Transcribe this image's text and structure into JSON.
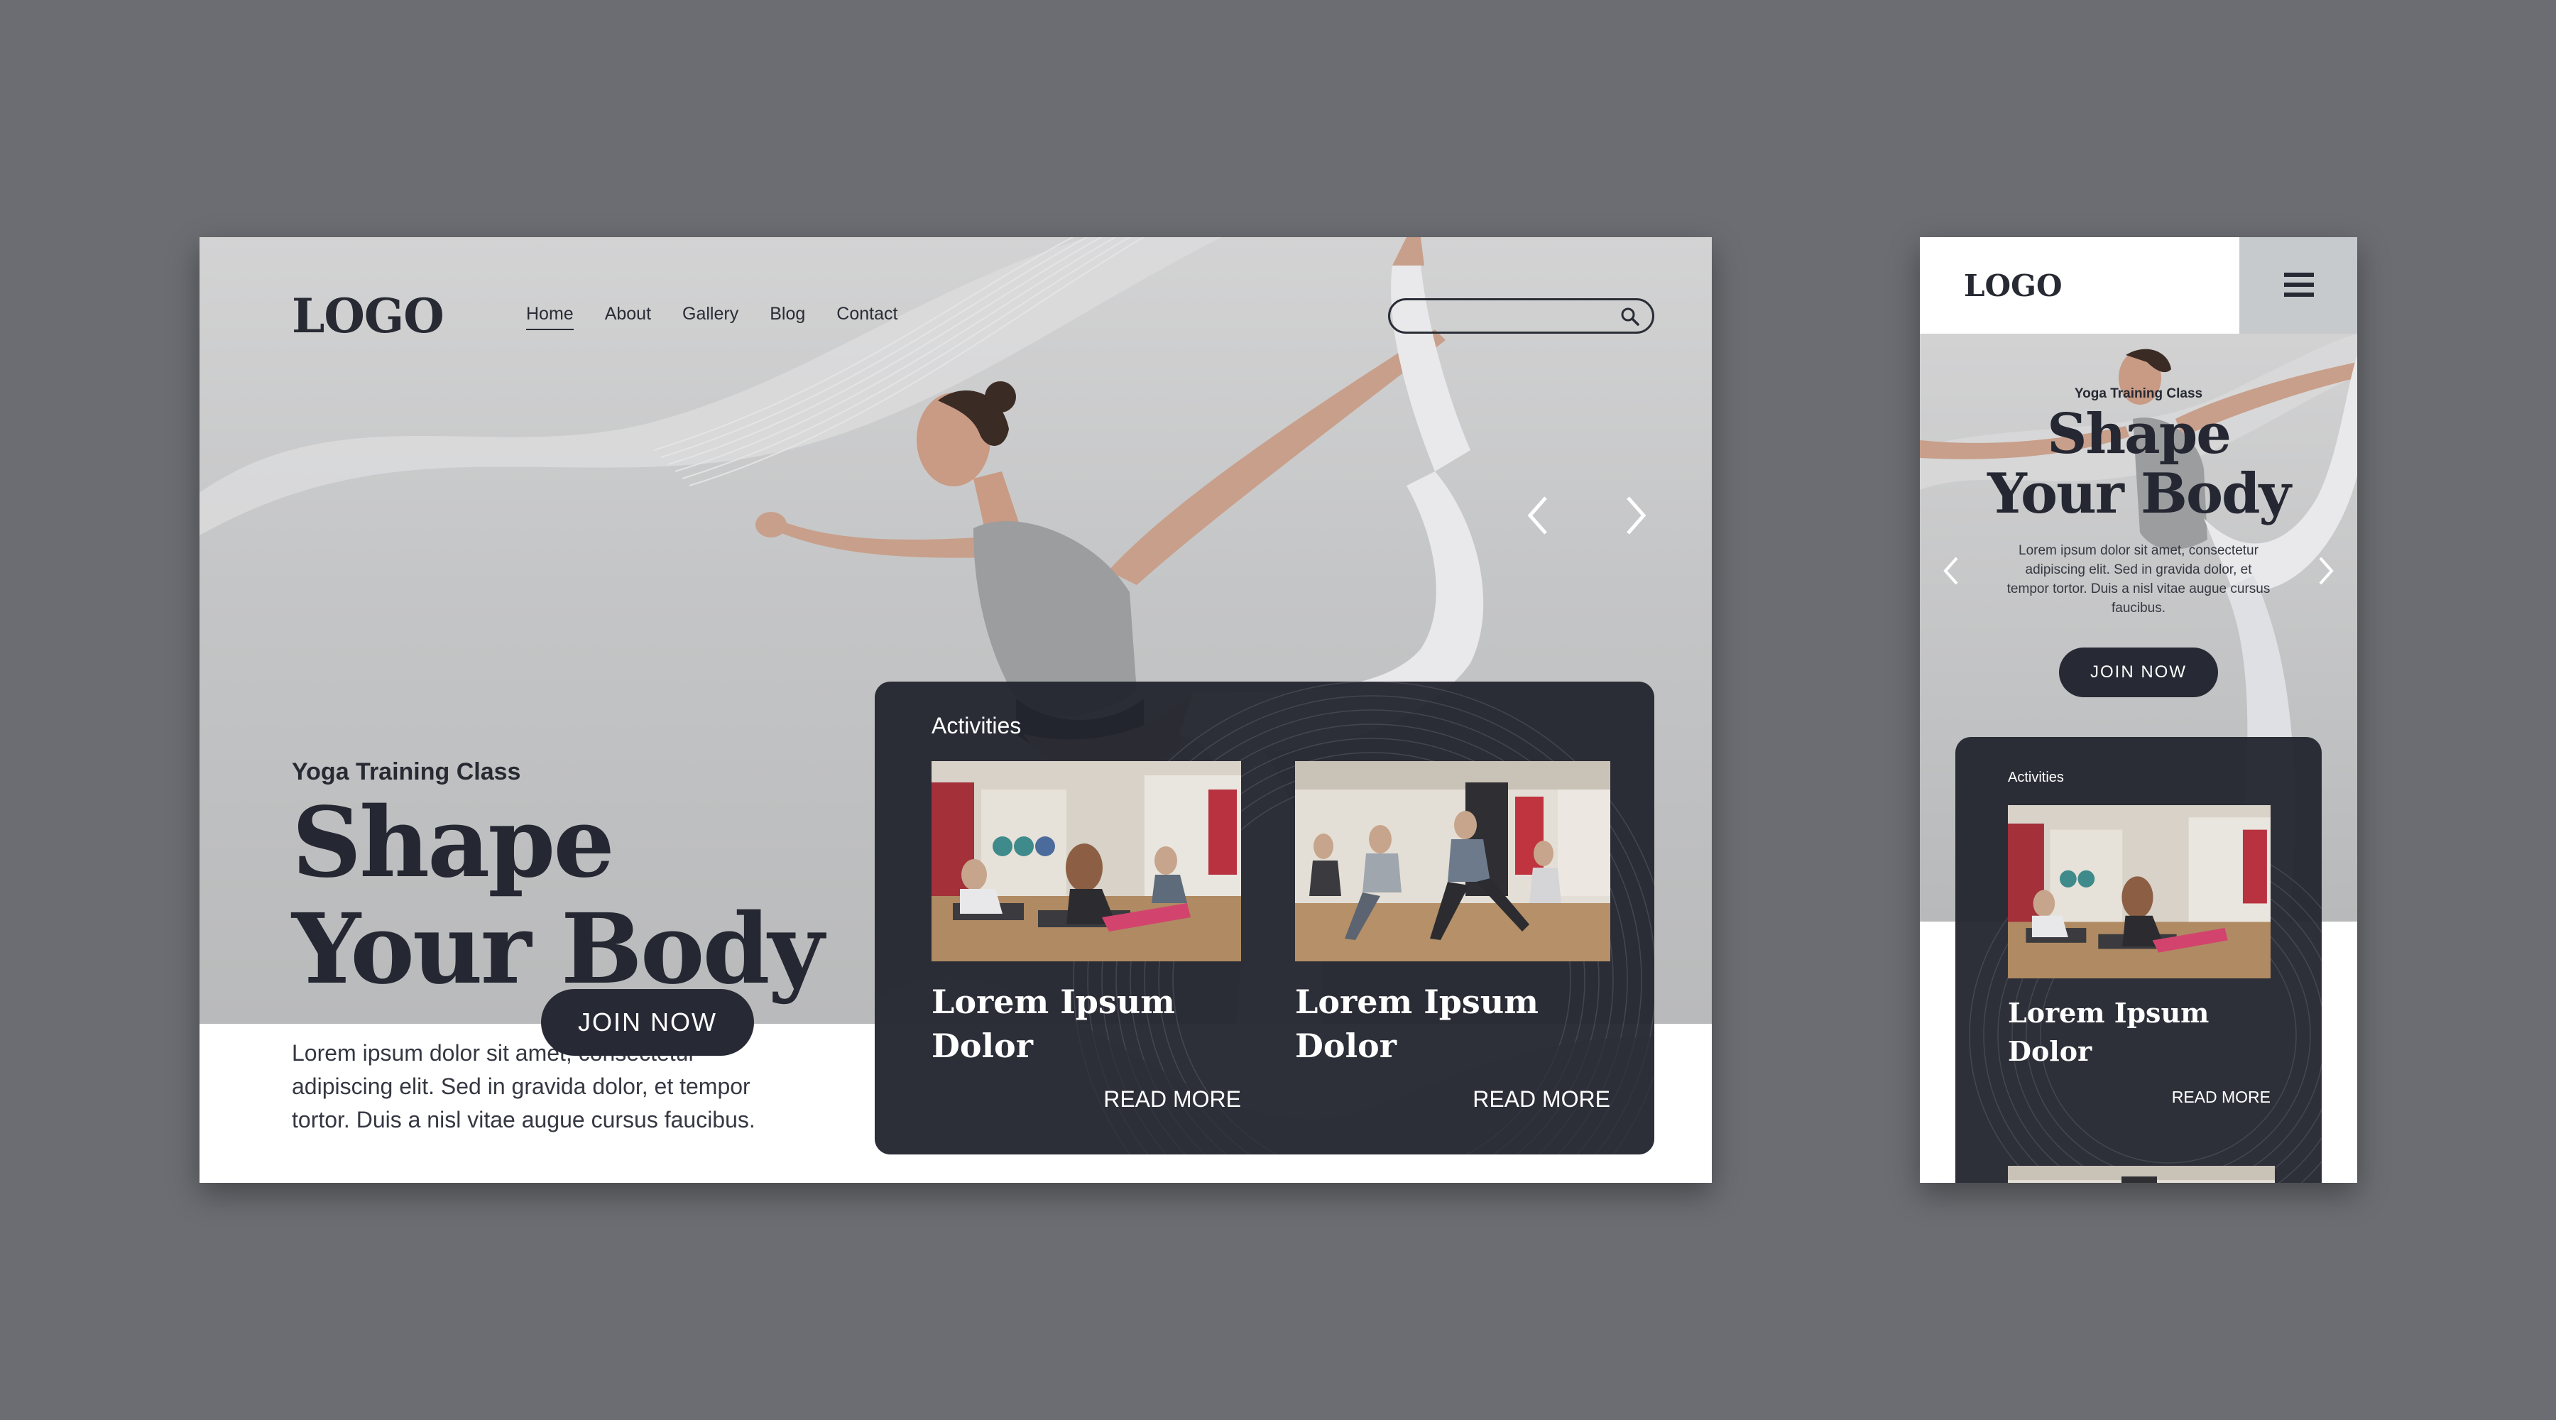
{
  "desktop": {
    "logo": "LOGO",
    "nav": [
      {
        "label": "Home",
        "active": true
      },
      {
        "label": "About",
        "active": false
      },
      {
        "label": "Gallery",
        "active": false
      },
      {
        "label": "Blog",
        "active": false
      },
      {
        "label": "Contact",
        "active": false
      }
    ],
    "search": {
      "placeholder": "",
      "value": "",
      "icon": "search-icon"
    },
    "hero": {
      "subtitle": "Yoga Training Class",
      "title_line1": "Shape",
      "title_line2": "Your Body",
      "body": "Lorem ipsum dolor sit amet, consectetur adipiscing elit. Sed in gravida dolor, et tempor tortor. Duis a nisl vitae augue cursus faucibus.",
      "cta": "JOIN NOW",
      "prev_icon": "chevron-left-icon",
      "next_icon": "chevron-right-icon"
    },
    "activities": {
      "label": "Activities",
      "items": [
        {
          "title_line1": "Lorem Ipsum",
          "title_line2": "Dolor",
          "link": "READ MORE"
        },
        {
          "title_line1": "Lorem Ipsum",
          "title_line2": "Dolor",
          "link": "READ MORE"
        }
      ]
    }
  },
  "mobile": {
    "logo": "LOGO",
    "menu_icon": "hamburger-menu-icon",
    "hero": {
      "subtitle": "Yoga Training Class",
      "title_line1": "Shape",
      "title_line2": "Your Body",
      "body": "Lorem ipsum dolor sit amet, consectetur adipiscing elit. Sed in gravida dolor, et tempor tortor. Duis a nisl vitae augue cursus faucibus.",
      "cta": "JOIN NOW"
    },
    "activities": {
      "label": "Activities",
      "items": [
        {
          "title_line1": "Lorem Ipsum",
          "title_line2": "Dolor",
          "link": "READ MORE"
        }
      ]
    }
  },
  "colors": {
    "background": "#6b6d72",
    "dark": "#272a35",
    "hero_gray": "#c4c5c6",
    "card": "#23252e",
    "white": "#ffffff"
  }
}
